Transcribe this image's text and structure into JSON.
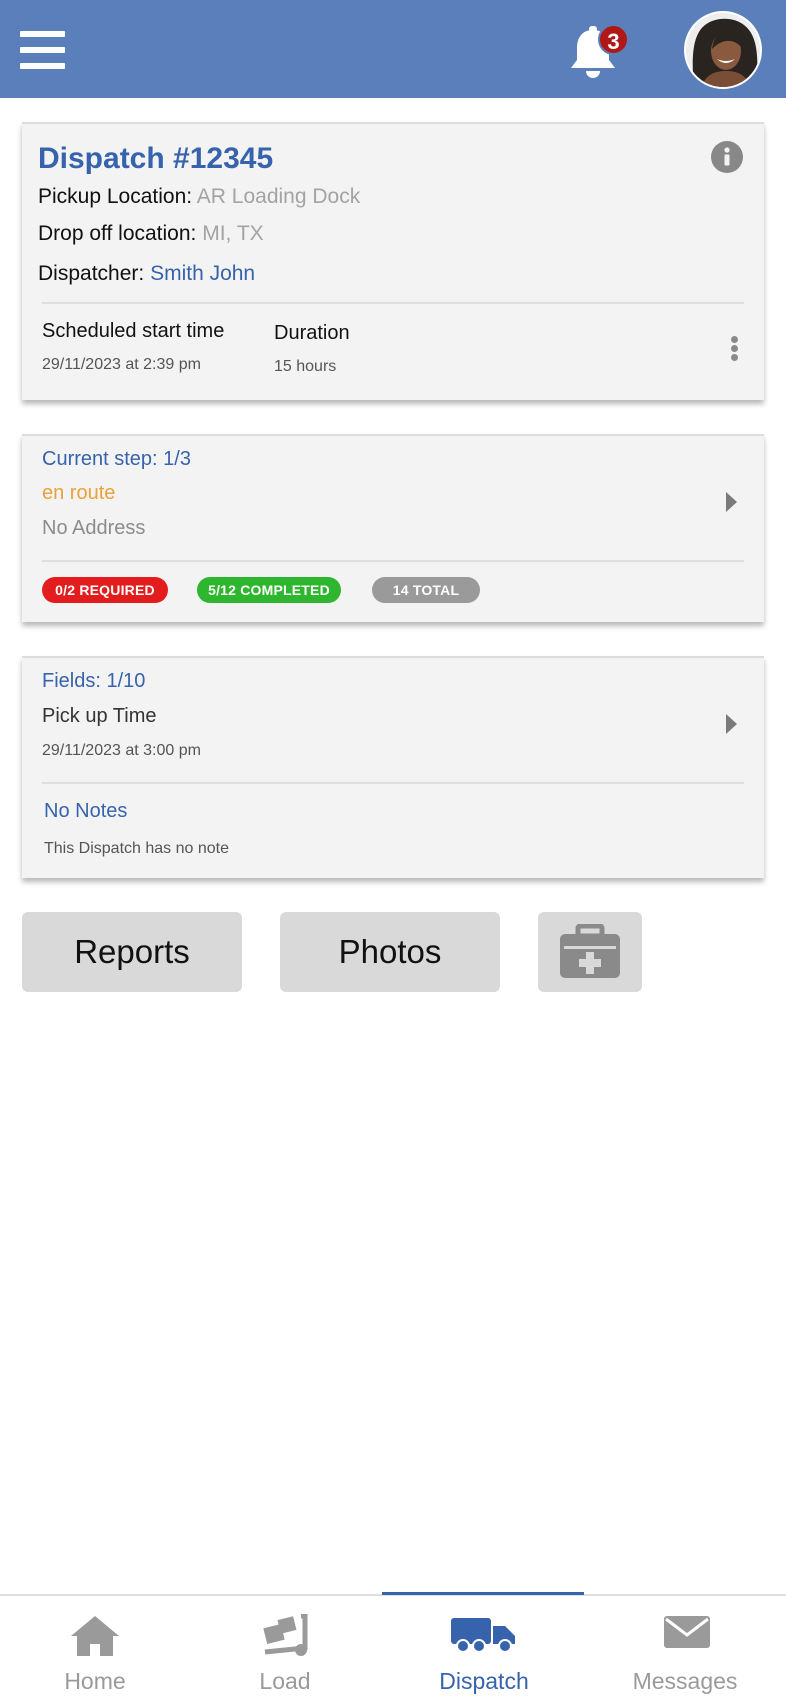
{
  "header": {
    "menu_icon": "hamburger-menu-icon",
    "notification_icon": "bell-icon",
    "notification_count": "3",
    "avatar": "user-avatar"
  },
  "dispatch": {
    "title": "Dispatch #12345",
    "pickup_label": "Pickup Location:",
    "pickup_value": "AR Loading Dock",
    "dropoff_label": "Drop off location:",
    "dropoff_value": "MI, TX",
    "dispatcher_label": "Dispatcher:",
    "dispatcher_value": "Smith John",
    "scheduled_label": "Scheduled start time",
    "scheduled_value": "29/11/2023 at 2:39 pm",
    "duration_label": "Duration",
    "duration_value": "15 hours"
  },
  "step": {
    "title": "Current step: 1/3",
    "status": "en route",
    "address": "No Address",
    "required_badge": "0/2 REQUIRED",
    "completed_badge": "5/12 COMPLETED",
    "total_badge": "14 TOTAL"
  },
  "fields": {
    "title": "Fields: 1/10",
    "name": "Pick up Time",
    "time": "29/11/2023 at 3:00 pm",
    "notes_title": "No Notes",
    "notes_text": "This Dispatch has no note"
  },
  "actions": {
    "reports_label": "Reports",
    "photos_label": "Photos",
    "add_icon": "medical-kit-add-icon"
  },
  "bottom_nav": {
    "items": [
      {
        "label": "Home",
        "icon": "home-icon"
      },
      {
        "label": "Load",
        "icon": "hand-truck-icon"
      },
      {
        "label": "Dispatch",
        "icon": "truck-icon"
      },
      {
        "label": "Messages",
        "icon": "envelope-icon"
      }
    ],
    "active": "Dispatch"
  },
  "colors": {
    "header": "#5b7fba",
    "accent": "#3763ac",
    "status_orange": "#e9a23a",
    "required_red": "#e31d1d",
    "completed_green": "#2eb72e",
    "total_gray": "#9a9a9a"
  }
}
